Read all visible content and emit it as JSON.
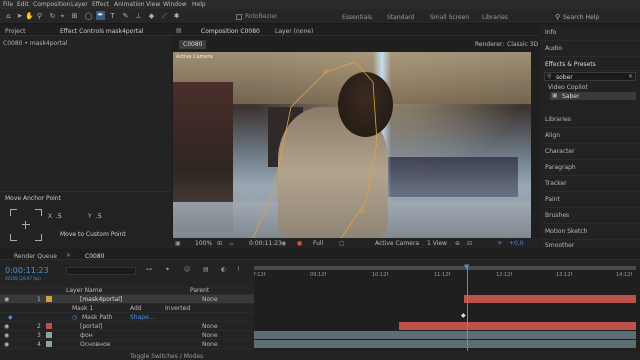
{
  "menu": [
    "File",
    "Edit",
    "Composition",
    "Layer",
    "Effect",
    "Animation",
    "View",
    "Window",
    "Help"
  ],
  "toolbar": {
    "tools": [
      "home-icon",
      "selection-icon",
      "hand-icon",
      "zoom-icon",
      "rotate-icon",
      "camera-icon",
      "pan-behind-icon",
      "rectangle-icon",
      "pen-icon",
      "type-icon",
      "brush-icon",
      "clone-icon",
      "eraser-icon",
      "roto-icon",
      "puppet-icon"
    ],
    "rotobezier": "RotoBezier",
    "workspaces": [
      "Essentials",
      "Standard",
      "Small Screen",
      "Libraries"
    ],
    "search": "Search Help"
  },
  "project": {
    "tab": "Project",
    "effect_controls": "Effect Controls mask4portal",
    "breadcrumb": "C0080 • mask4portal",
    "anchor_title": "Move Anchor Point",
    "x_label": "X",
    "x_value": ".5",
    "y_label": "Y",
    "y_value": ".5",
    "move_button": "Move to Custom Point"
  },
  "viewer": {
    "tab": "Composition C0080",
    "layer_tab": "Layer (none)",
    "comp_tag": "C0080",
    "renderer": "Renderer:",
    "renderer_value": "Classic 3D",
    "camera_label": "Active Camera",
    "footer": {
      "zoom": "100%",
      "time": "0:00:11:23",
      "quality": "Full",
      "camera": "Active Camera",
      "view": "1 View",
      "offset": "+0,0"
    }
  },
  "right": {
    "items": [
      "Info",
      "Audio",
      "Effects & Presets"
    ],
    "search_value": "sober",
    "video_copilot": "Video Copilot",
    "saber": "Saber",
    "panels": [
      "Libraries",
      "Align",
      "Character",
      "Paragraph",
      "Tracker",
      "Paint",
      "Brushes",
      "Motion Sketch",
      "Smoother"
    ]
  },
  "timeline": {
    "render_queue": "Render Queue",
    "comp_tab": "C0080",
    "timecode": "0:00:11:23",
    "fps": "00358 (29.97 fps)",
    "col_layer": "Layer Name",
    "col_parent": "Parent",
    "ticks": [
      "f:12f",
      "09:12f",
      "10:12f",
      "11:12f",
      "12:12f",
      "13:12f",
      "14:12f"
    ],
    "layers": [
      {
        "num": "1",
        "name": "[mask4portal]",
        "parent": "None"
      },
      {
        "num": "",
        "name": "Mask 1",
        "mode": "Add",
        "inverted": "Inverted"
      },
      {
        "num": "",
        "name": "Mask Path",
        "value": "Shape..."
      },
      {
        "num": "2",
        "name": "[portal]",
        "parent": "None"
      },
      {
        "num": "3",
        "name": "фон",
        "parent": "None"
      },
      {
        "num": "4",
        "name": "Основное",
        "parent": "None"
      }
    ],
    "footer": "Toggle Switches / Modes"
  },
  "colors": {
    "accent": "#4c8fd6",
    "track_red": "#b9534c",
    "track_gray": "#5e6f73",
    "playhead": "#4c8fd6"
  }
}
